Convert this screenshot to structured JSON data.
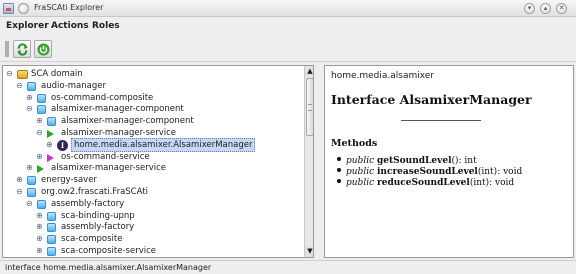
{
  "window": {
    "title": "FraSCAti Explorer"
  },
  "menu": {
    "items": [
      "Explorer",
      "Actions",
      "Roles"
    ]
  },
  "toolbar": {
    "buttons": [
      "refresh-icon",
      "power-icon"
    ]
  },
  "tree": [
    {
      "label": "SCA domain",
      "icon": "domain",
      "toggle": "⊖"
    },
    {
      "label": "audio-manager",
      "icon": "folder",
      "toggle": "⊖"
    },
    {
      "label": "os-command-composite",
      "icon": "folder",
      "toggle": "⊕"
    },
    {
      "label": "alsamixer-manager-component",
      "icon": "folder",
      "toggle": "⊖"
    },
    {
      "label": "alsamixer-manager-component",
      "icon": "folder",
      "toggle": "⊕"
    },
    {
      "label": "alsamixer-manager-service",
      "icon": "service",
      "toggle": "⊖"
    },
    {
      "label": "home.media.alsamixer.AlsamixerManager",
      "icon": "interface",
      "toggle": "⊕",
      "selected": true
    },
    {
      "label": "os-command-service",
      "icon": "reference",
      "toggle": "⊕"
    },
    {
      "label": "alsamixer-manager-service",
      "icon": "service",
      "toggle": "⊕"
    },
    {
      "label": "energy-saver",
      "icon": "folder",
      "toggle": "⊕"
    },
    {
      "label": "org.ow2.frascati.FraSCAti",
      "icon": "folder",
      "toggle": "⊖"
    },
    {
      "label": "assembly-factory",
      "icon": "folder",
      "toggle": "⊖"
    },
    {
      "label": "sca-binding-upnp",
      "icon": "folder",
      "toggle": "⊕"
    },
    {
      "label": "assembly-factory",
      "icon": "folder",
      "toggle": "⊕"
    },
    {
      "label": "sca-composite",
      "icon": "folder",
      "toggle": "⊕"
    },
    {
      "label": "sca-composite-service",
      "icon": "folder",
      "toggle": "⊕"
    }
  ],
  "details": {
    "package": "home.media.alsamixer",
    "title": "Interface AlsamixerManager",
    "methods_heading": "Methods",
    "methods": [
      {
        "modifier": "public",
        "name": "getSoundLevel",
        "params": "()",
        "returns": ": int"
      },
      {
        "modifier": "public",
        "name": "increaseSoundLevel",
        "params": "(int)",
        "returns": ": void"
      },
      {
        "modifier": "public",
        "name": "reduceSoundLevel",
        "params": "(int)",
        "returns": ": void"
      }
    ]
  },
  "status": {
    "text": "interface home.media.alsamixer.AlsamixerManager"
  },
  "colors": {
    "selection": "#c6d8f4",
    "folder": "#55aee6",
    "service": "#33a12e",
    "reference": "#c23ac9",
    "interface": "#34245a"
  }
}
